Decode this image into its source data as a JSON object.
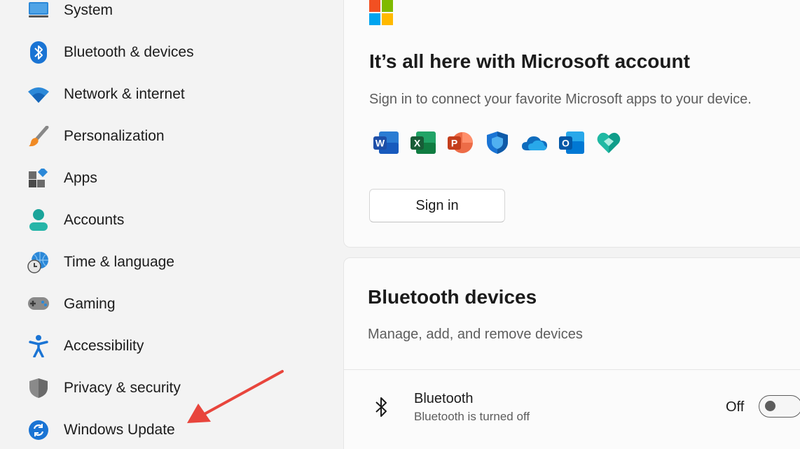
{
  "sidebar": {
    "items": [
      {
        "label": "System",
        "icon": "system-icon"
      },
      {
        "label": "Bluetooth & devices",
        "icon": "bluetooth-icon"
      },
      {
        "label": "Network & internet",
        "icon": "wifi-icon"
      },
      {
        "label": "Personalization",
        "icon": "paintbrush-icon"
      },
      {
        "label": "Apps",
        "icon": "apps-icon"
      },
      {
        "label": "Accounts",
        "icon": "person-icon"
      },
      {
        "label": "Time & language",
        "icon": "globe-clock-icon"
      },
      {
        "label": "Gaming",
        "icon": "gamepad-icon"
      },
      {
        "label": "Accessibility",
        "icon": "accessibility-icon"
      },
      {
        "label": "Privacy & security",
        "icon": "shield-icon"
      },
      {
        "label": "Windows Update",
        "icon": "refresh-icon"
      }
    ]
  },
  "promo": {
    "title": "It’s all here with Microsoft account",
    "subtitle": "Sign in to connect your favorite Microsoft apps to your device.",
    "app_icons": [
      "word-icon",
      "excel-icon",
      "powerpoint-icon",
      "defender-icon",
      "onedrive-icon",
      "outlook-icon",
      "family-icon"
    ],
    "signin_label": "Sign in"
  },
  "bluetooth": {
    "title": "Bluetooth devices",
    "subtitle": "Manage, add, and remove devices",
    "row_title": "Bluetooth",
    "row_subtitle": "Bluetooth is turned off",
    "toggle_state": "Off"
  },
  "colors": {
    "accent": "#0067c0",
    "annotation": "#e8453c"
  }
}
